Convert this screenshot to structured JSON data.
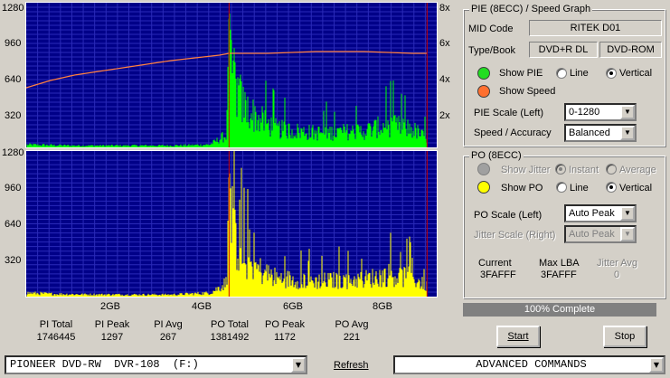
{
  "chart_data": [
    {
      "type": "area",
      "title": "PIE",
      "left_ticks": [
        "1280",
        "960",
        "640",
        "320"
      ],
      "right_ticks": [
        "8x",
        "6x",
        "4x",
        "2x"
      ],
      "ylim": [
        0,
        1280
      ],
      "speed_ylim": [
        0,
        8
      ],
      "x_ticks": [
        "2GB",
        "4GB",
        "6GB",
        "8GB"
      ],
      "xlim": [
        0,
        8.5
      ],
      "color": "#00ff00",
      "speed_color": "#ff8040",
      "marker_color": "#cc0000",
      "layer_break_gb": 4.2,
      "end_gb": 8.3,
      "pie_profile_x": [
        0,
        0.5,
        1,
        2,
        3,
        3.8,
        4.0,
        4.15,
        4.2,
        4.25,
        4.35,
        4.5,
        4.8,
        5.2,
        6,
        7,
        7.5,
        8,
        8.3
      ],
      "pie_profile_y": [
        30,
        25,
        20,
        20,
        20,
        30,
        90,
        140,
        1280,
        900,
        650,
        450,
        320,
        200,
        160,
        180,
        250,
        200,
        100
      ],
      "speed_x": [
        0,
        0.5,
        1,
        2,
        3,
        4,
        4.2,
        5,
        6,
        7,
        8,
        8.3
      ],
      "speed_y": [
        3.3,
        3.7,
        4.0,
        4.4,
        4.8,
        5.1,
        5.2,
        5.2,
        5.3,
        5.3,
        5.2,
        5.2
      ]
    },
    {
      "type": "area",
      "title": "PO",
      "left_ticks": [
        "1280",
        "960",
        "640",
        "320"
      ],
      "ylim": [
        0,
        1280
      ],
      "x_ticks": [
        "2GB",
        "4GB",
        "6GB",
        "8GB"
      ],
      "xlim": [
        0,
        8.5
      ],
      "color": "#ffff00",
      "marker_color": "#cc0000",
      "layer_break_gb": 4.2,
      "end_gb": 8.3,
      "po_profile_x": [
        0,
        0.5,
        1,
        2,
        3,
        3.8,
        4.0,
        4.15,
        4.2,
        4.25,
        4.35,
        4.5,
        4.8,
        5.2,
        6,
        7,
        7.5,
        8,
        8.3
      ],
      "po_profile_y": [
        40,
        30,
        25,
        22,
        22,
        40,
        100,
        160,
        1172,
        820,
        600,
        420,
        300,
        200,
        170,
        190,
        240,
        210,
        110
      ]
    }
  ],
  "stats": [
    {
      "label": "PI Total",
      "value": "1746445"
    },
    {
      "label": "PI Peak",
      "value": "1297"
    },
    {
      "label": "PI Avg",
      "value": "267"
    },
    {
      "label": "PO Total",
      "value": "1381492"
    },
    {
      "label": "PO Peak",
      "value": "1172"
    },
    {
      "label": "PO Avg",
      "value": "221"
    }
  ],
  "pie_group": {
    "title": "PIE (8ECC) / Speed Graph",
    "mid_label": "MID Code",
    "mid_value": "RITEK    D01",
    "type_label": "Type/Book",
    "type_value": "DVD+R DL",
    "book_value": "DVD-ROM",
    "show_pie": "Show PIE",
    "line": "Line",
    "vertical": "Vertical",
    "show_speed": "Show Speed",
    "scale_label": "PIE Scale (Left)",
    "scale_value": "0-1280",
    "accuracy_label": "Speed / Accuracy",
    "accuracy_value": "Balanced",
    "pie_color": "#22dd22",
    "speed_color": "#ff7030"
  },
  "po_group": {
    "title": "PO (8ECC)",
    "show_jitter": "Show Jitter",
    "instant": "Instant",
    "average": "Average",
    "show_po": "Show PO",
    "line": "Line",
    "vertical": "Vertical",
    "scale_label": "PO Scale (Left)",
    "scale_value": "Auto Peak",
    "jitter_label": "Jitter Scale (Right)",
    "jitter_value": "Auto Peak",
    "current_label": "Current",
    "current_value": "3FAFFF",
    "maxlba_label": "Max LBA",
    "maxlba_value": "3FAFFF",
    "jitter_avg_label": "Jitter Avg",
    "jitter_avg_value": "0",
    "po_color": "#ffff00"
  },
  "progress": {
    "text": "100% Complete",
    "value": 1.0
  },
  "buttons": {
    "start": "Start",
    "stop": "Stop",
    "refresh": "Refresh"
  },
  "drive": "PIONEER DVD-RW  DVR-108  (F:)",
  "commands": "ADVANCED COMMANDS"
}
